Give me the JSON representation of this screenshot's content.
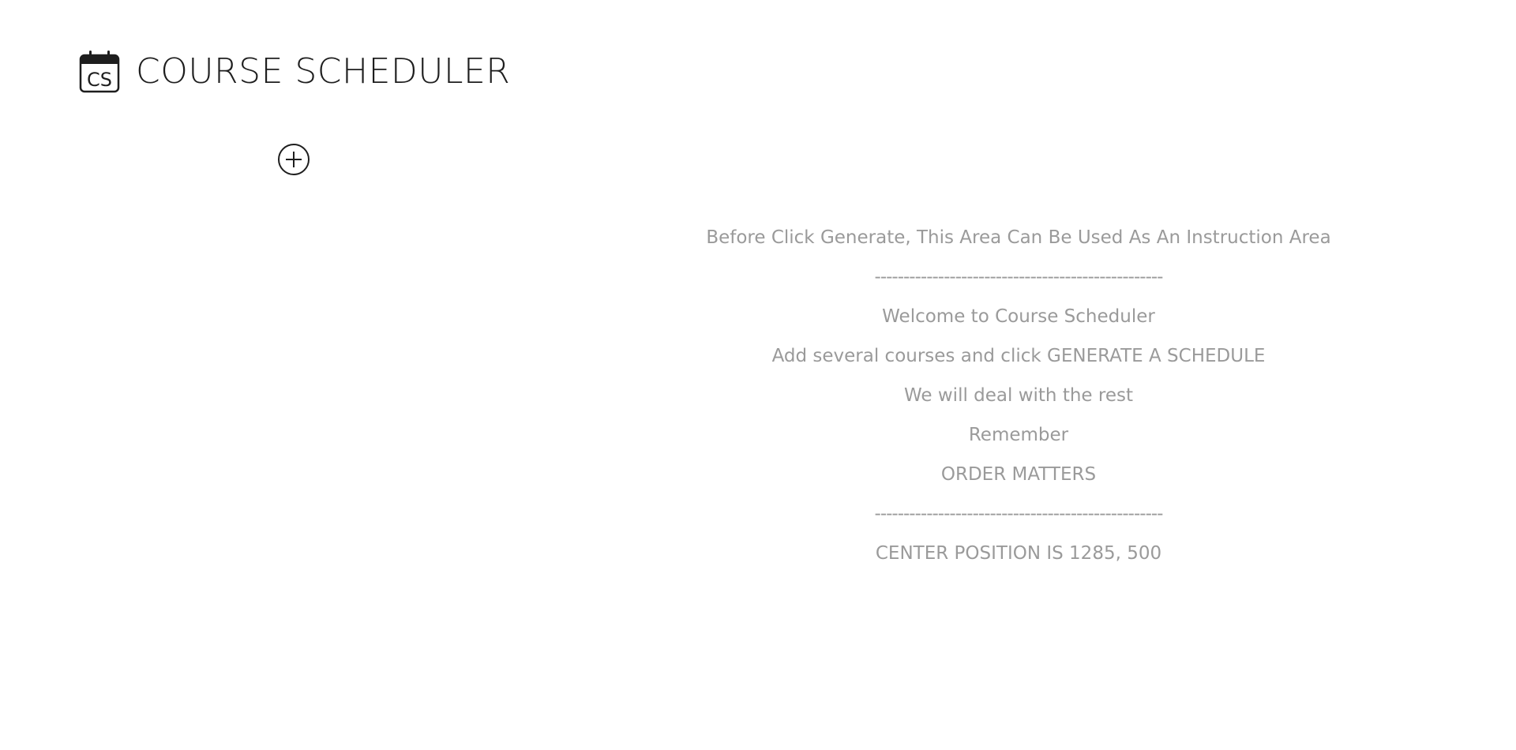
{
  "app": {
    "title": "COURSE SCHEDULER",
    "logo_text": "CS",
    "logo_icon": "calendar-icon"
  },
  "toolbar": {
    "add_course_icon": "plus-circle-icon"
  },
  "instructions": {
    "heading": "Before Click Generate, This Area Can Be Used As An Instruction Area",
    "divider": "--------------------------------------------------",
    "welcome": "Welcome to Course Scheduler",
    "step": "Add several courses and click GENERATE A SCHEDULE",
    "rest": "We will deal with the rest",
    "remember": "Remember",
    "order": "ORDER MATTERS",
    "divider_bottom": "--------------------------------------------------",
    "center": "CENTER POSITION IS 1285, 500"
  },
  "colors": {
    "title": "#1e1e1e",
    "instruction_text": "#9a9a9a",
    "background": "#ffffff"
  }
}
